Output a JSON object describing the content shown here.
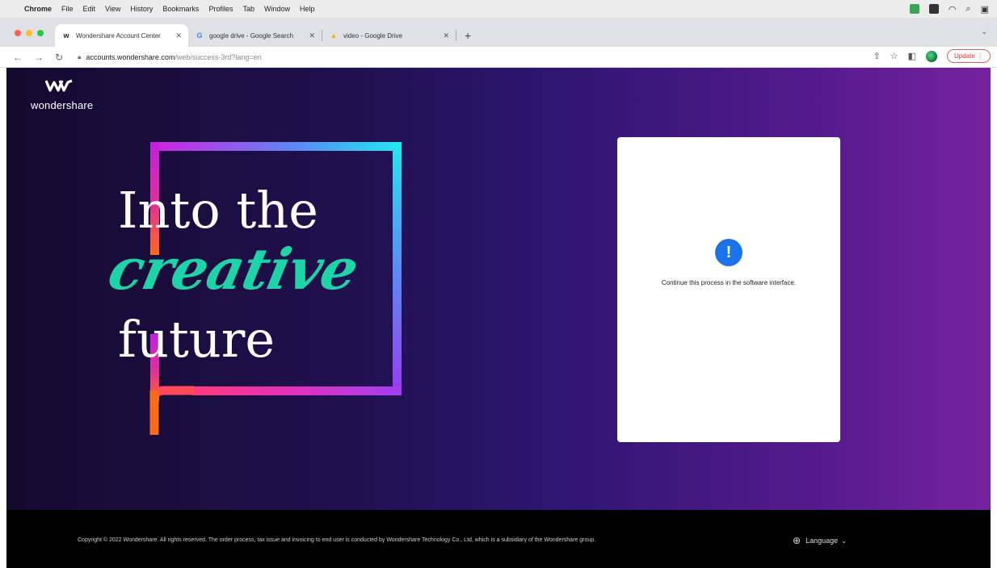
{
  "menubar": {
    "apple_icon": "apple-icon",
    "app_name": "Chrome",
    "items": [
      "File",
      "Edit",
      "View",
      "History",
      "Bookmarks",
      "Profiles",
      "Tab",
      "Window",
      "Help"
    ]
  },
  "tabs": [
    {
      "title": "Wondershare Account Center",
      "favicon": "w",
      "active": true
    },
    {
      "title": "google drive - Google Search",
      "favicon": "G",
      "active": false
    },
    {
      "title": "video - Google Drive",
      "favicon": "▲",
      "active": false
    }
  ],
  "address": {
    "host": "accounts.wondershare.com",
    "path": "/web/success-3rd?lang=en",
    "update_label": "Update"
  },
  "page": {
    "logo_text": "wondershare",
    "hero_line1": "Into the",
    "hero_line2": "creative",
    "hero_line3": "future",
    "card_message": "Continue this process in the software interface.",
    "alert_glyph": "!"
  },
  "footer": {
    "copyright": "Copyright © 2022 Wondershare. All rights reserved. The order process, tax issue and invoicing to end user is conducted by Wondershare Technology Co., Ltd, which is a subsidiary of the Wondershare group.",
    "language_label": "Language"
  },
  "colors": {
    "accent_blue": "#1a73e8",
    "hero_teal": "#1fd3a8",
    "update_red": "#d33"
  }
}
